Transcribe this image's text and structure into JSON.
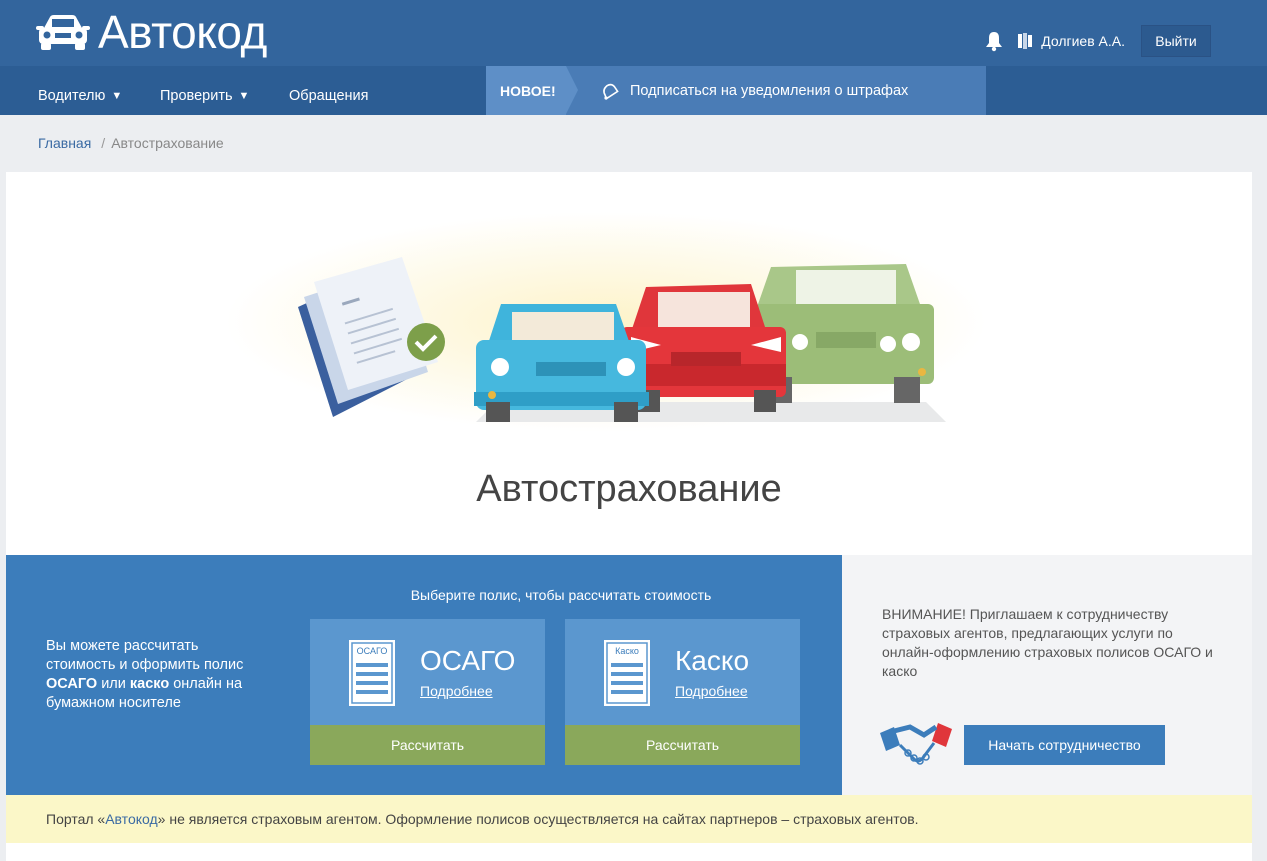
{
  "header": {
    "logo_text": "Автокод",
    "user_name": "Долгиев А.А.",
    "logout_label": "Выйти"
  },
  "nav": {
    "items": [
      {
        "label": "Водителю",
        "has_dropdown": true
      },
      {
        "label": "Проверить",
        "has_dropdown": true
      },
      {
        "label": "Обращения",
        "has_dropdown": false
      }
    ],
    "dropdown_arrow": "▼",
    "new_tag": "НОВОЕ!",
    "subscribe_label": "Подписаться на уведомления о штрафах"
  },
  "breadcrumb": {
    "home": "Главная",
    "separator": "/",
    "current": "Автострахование"
  },
  "main": {
    "title": "Автострахование"
  },
  "calculator": {
    "title": "Выберите полис, чтобы рассчитать стоимость",
    "text_part1": "Вы можете рассчитать стоимость и оформить полис ",
    "text_bold1": "ОСАГО",
    "text_part2": " или ",
    "text_bold2": "каско",
    "text_part3": " онлайн на бумажном носителе",
    "policies": [
      {
        "name": "ОСАГО",
        "doc_label": "ОСАГО",
        "more_label": "Подробнее",
        "button_label": "Рассчитать"
      },
      {
        "name": "Каско",
        "doc_label": "Каско",
        "more_label": "Подробнее",
        "button_label": "Рассчитать"
      }
    ]
  },
  "partner": {
    "text": "ВНИМАНИЕ! Приглашаем к сотрудничеству страховых агентов, предлагающих услуги по онлайн-оформлению страховых полисов ОСАГО и каско",
    "button_label": "Начать сотрудничество"
  },
  "notice": {
    "prefix": "Портал «",
    "link": "Автокод",
    "suffix": "» не является страховым агентом. Оформление полисов осуществляется на сайтах партнеров – страховых агентов."
  },
  "colors": {
    "header_bg": "#33659d",
    "nav_bg": "#2c5d94",
    "calc_bg": "#3c7dbb",
    "policy_bg": "#5b97cf",
    "calc_button": "#8aa85b",
    "notice_bg": "#fbf7c8"
  }
}
